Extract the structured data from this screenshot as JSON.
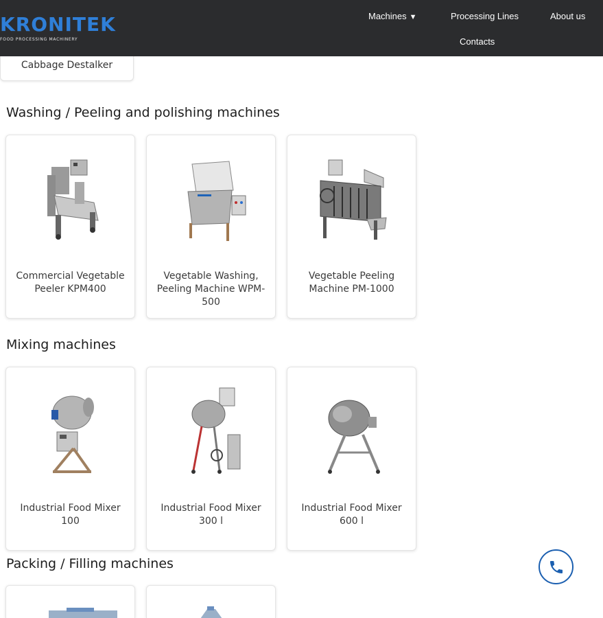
{
  "header": {
    "logo_text": "KRONITEK",
    "logo_subtitle": "FOOD PROCESSING MACHINERY",
    "nav": {
      "machines": "Machines",
      "processing_lines": "Processing Lines",
      "about": "About us",
      "contacts": "Contacts"
    },
    "caret": "▼"
  },
  "previous_card": {
    "label": "Cabbage Destalker"
  },
  "sections": [
    {
      "title": "Washing / Peeling and polishing machines",
      "products": [
        {
          "label": "Commercial Vegetable Peeler KPM400"
        },
        {
          "label": "Vegetable Washing, Peeling Machine WPM-500"
        },
        {
          "label": "Vegetable Peeling Machine PM-1000"
        }
      ]
    },
    {
      "title": "Mixing machines",
      "products": [
        {
          "label": "Industrial Food Mixer 100"
        },
        {
          "label": "Industrial Food Mixer 300 l"
        },
        {
          "label": "Industrial Food Mixer 600 l"
        }
      ]
    },
    {
      "title": "Packing / Filling machines"
    }
  ],
  "colors": {
    "header_bg": "#2b2c2e",
    "logo_blue": "#2f7fd8",
    "phone_blue": "#1b5fb0"
  },
  "icons": {
    "phone": "phone-icon"
  }
}
